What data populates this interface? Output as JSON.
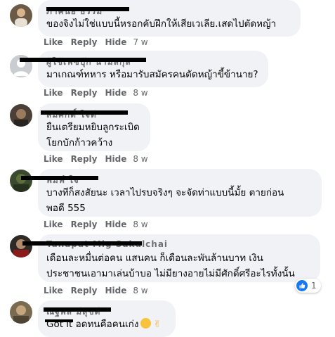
{
  "comments": [
    {
      "author": "ภาคินัย ธรรม",
      "text": "ของจิงไม่ใช่แบบนี้หรอกคับฝึกให้เสียเวเลีย.เสดไปตัดหญ้า",
      "actions": {
        "like": "Like",
        "reply": "Reply",
        "hide": "Hide",
        "time": "7 w"
      }
    },
    {
      "author": "ผู้ใช้เฟซบุ๊ก นามสกุล",
      "text": "มาเกณฑ์ทหาร หรือมารับสมัครคนตัดหญ้าขี้ข้านาย?",
      "actions": {
        "like": "Like",
        "reply": "Reply",
        "hide": "Hide",
        "time": "8 w"
      }
    },
    {
      "author": "สมศักดิ์ ใจดี",
      "text": "ยืนเตรียมหยิบลูกระเบิด\nโยกบักก้าวคว้าง",
      "actions": {
        "like": "Like",
        "reply": "Reply",
        "hide": "Hide",
        "time": "8 w"
      }
    },
    {
      "author": "พิมพ์ ใจ",
      "text": "บางทีก็สงสัยนะ เวลาไปรบจริงๆ จะจัดท่าแบบนี้มั้ย ตายก่อน\nพอดี 555",
      "actions": {
        "like": "Like",
        "reply": "Reply",
        "hide": "Hide",
        "time": "8 w"
      }
    },
    {
      "author": "Tanapat Mig Sakulchai",
      "text": "เดือนละหมื่นต่อคน แสนคน ก็เดือนละพันล้านบาท เงิน\nประชาชนเอามาเล่นบ้าบอ ไม่มียางอายไม่มีศักดิ์ศรีอะไรทั้งนั้น",
      "actions": {
        "like": "Like",
        "reply": "Reply",
        "hide": "Hide",
        "time": "8 w"
      },
      "reaction": {
        "icon": "like-icon",
        "count": "1"
      }
    },
    {
      "author": "ณัฐพล มีสุขดี",
      "text": "Got it อดทนคือคนเก่ง",
      "actions": {
        "like": "Like",
        "reply": "Reply",
        "hide": "Hide",
        "time": "8 w"
      },
      "emoji": [
        "smiling-face-icon",
        "victory-hand-icon"
      ]
    }
  ],
  "colors": {
    "bubble": "#f0f2f5",
    "meta": "#65676b",
    "like": "#1877f2"
  }
}
